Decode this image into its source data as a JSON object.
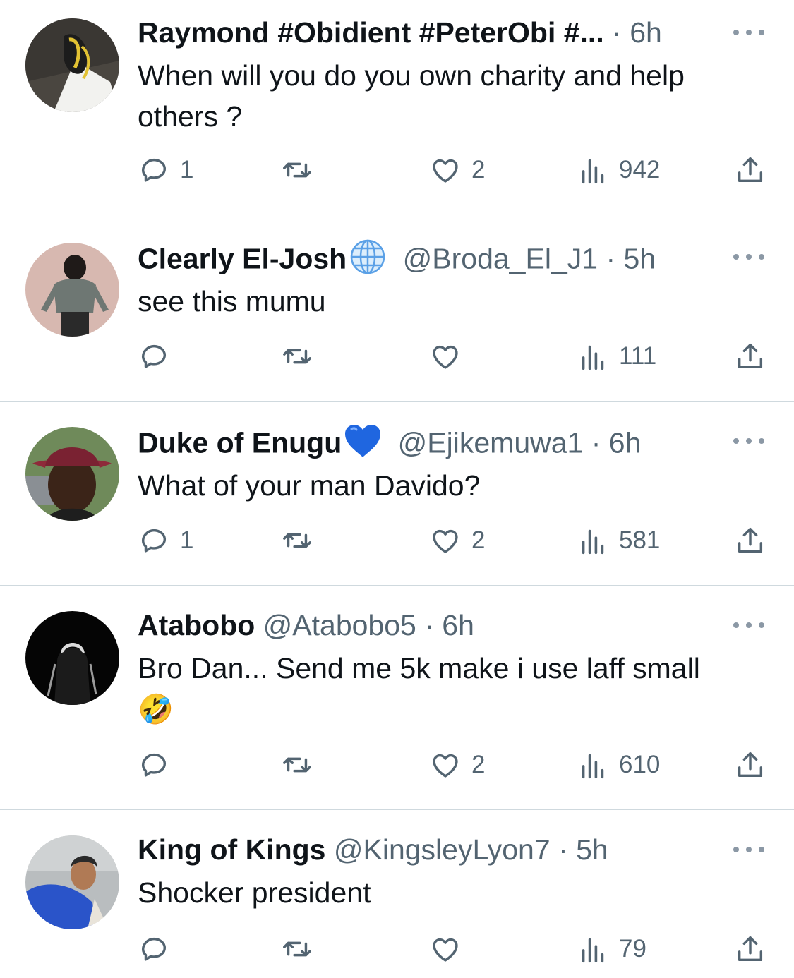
{
  "tweets": [
    {
      "name": "Raymond #Obidient #PeterObi #...",
      "badge": "",
      "handle": "",
      "dot": "·",
      "time": "6h",
      "text_lines": [
        "When will you do you own charity and help",
        "others ?"
      ],
      "replies": "1",
      "retweets": "",
      "likes": "2",
      "views": "942"
    },
    {
      "name": "Clearly El-Josh",
      "badge": "globe-emoji",
      "handle": "@Broda_El_J1",
      "dot": "·",
      "time": "5h",
      "text_lines": [
        "see this mumu"
      ],
      "replies": "",
      "retweets": "",
      "likes": "",
      "views": "111"
    },
    {
      "name": "Duke of Enugu",
      "badge": "blue-heart-emoji",
      "handle": "@Ejikemuwa1",
      "dot": "·",
      "time": "6h",
      "text_lines": [
        "What of your man Davido?"
      ],
      "replies": "1",
      "retweets": "",
      "likes": "2",
      "views": "581"
    },
    {
      "name": "Atabobo",
      "badge": "",
      "handle": "@Atabobo5",
      "dot": "·",
      "time": "6h",
      "text_lines": [
        "Bro Dan... Send me 5k make i use laff small",
        "🤣"
      ],
      "replies": "",
      "retweets": "",
      "likes": "2",
      "views": "610"
    },
    {
      "name": "King of Kings",
      "badge": "",
      "handle": "@KingsleyLyon7",
      "dot": "·",
      "time": "5h",
      "text_lines": [
        "Shocker president"
      ],
      "replies": "",
      "retweets": "",
      "likes": "",
      "views": "79"
    }
  ],
  "colors": {
    "text": "#0f1419",
    "secondary": "#536471",
    "divider": "#cfd9de",
    "more_dots": "#8b98a5"
  },
  "icons": [
    "reply-icon",
    "retweet-icon",
    "like-icon",
    "views-icon",
    "share-icon",
    "more-icon"
  ]
}
